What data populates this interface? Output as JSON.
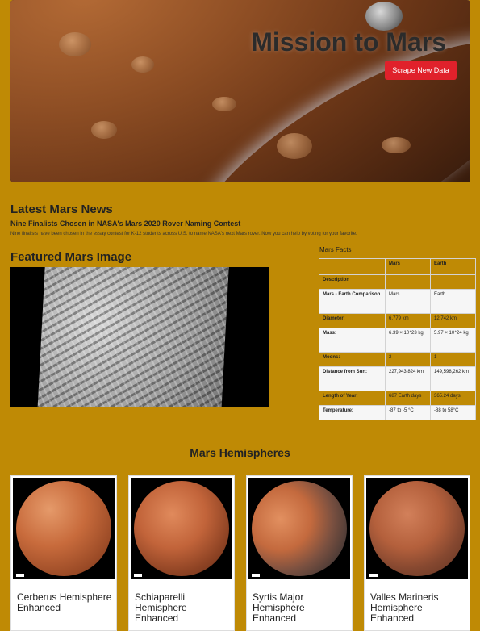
{
  "header": {
    "title": "Mission to Mars",
    "scrape_button_label": "Scrape New Data"
  },
  "news": {
    "heading": "Latest Mars News",
    "title": "Nine Finalists Chosen in NASA's Mars 2020 Rover Naming Contest",
    "teaser": "Nine finalists have been chosen in the essay contest for K-12 students across U.S. to name NASA's next Mars rover. Now you can help by voting for your favorite."
  },
  "featured": {
    "heading": "Featured Mars Image"
  },
  "facts": {
    "heading": "Mars Facts",
    "columns": [
      "",
      "Mars",
      "Earth"
    ],
    "rows": [
      {
        "label": "Description",
        "mars": "",
        "earth": ""
      },
      {
        "label": "Mars - Earth Comparison",
        "mars": "Mars",
        "earth": "Earth"
      },
      {
        "label": "Diameter:",
        "mars": "6,779 km",
        "earth": "12,742 km"
      },
      {
        "label": "Mass:",
        "mars": "6.39 × 10^23 kg",
        "earth": "5.97 × 10^24 kg"
      },
      {
        "label": "Moons:",
        "mars": "2",
        "earth": "1"
      },
      {
        "label": "Distance from Sun:",
        "mars": "227,943,824 km",
        "earth": "149,598,262 km"
      },
      {
        "label": "Length of Year:",
        "mars": "687 Earth days",
        "earth": "365.24 days"
      },
      {
        "label": "Temperature:",
        "mars": "-87 to -5 °C",
        "earth": "-88 to 58°C"
      }
    ]
  },
  "hemispheres": {
    "heading": "Mars Hemispheres",
    "items": [
      {
        "title": "Cerberus Hemisphere Enhanced"
      },
      {
        "title": "Schiaparelli Hemisphere Enhanced"
      },
      {
        "title": "Syrtis Major Hemisphere Enhanced"
      },
      {
        "title": "Valles Marineris Hemisphere Enhanced"
      }
    ]
  },
  "colors": {
    "page_background": "#bf8a05",
    "button_red": "#e0212b"
  }
}
